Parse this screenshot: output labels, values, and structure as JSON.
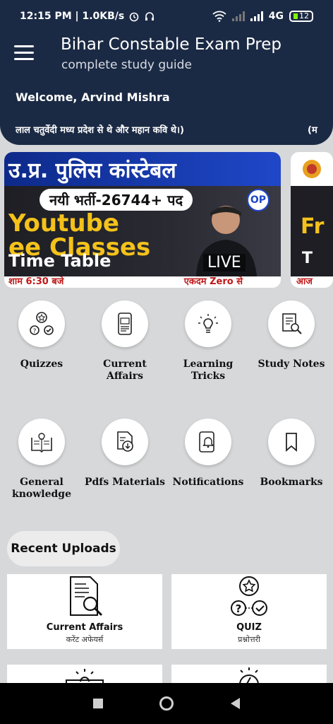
{
  "status": {
    "time": "12:15 PM | 1.0KB/s",
    "network": "4G",
    "battery": "12"
  },
  "header": {
    "title": "Bihar Constable Exam Prep",
    "subtitle": "complete study guide"
  },
  "welcome": {
    "text": "Welcome, Arvind Mishra",
    "marquee": "लाल चतुर्वेदी मध्य प्रदेश से थे और महान कवि थे।)",
    "marquee_tail": "(म"
  },
  "banner": {
    "headline": "उ.प्र. पुलिस कांस्टेबल",
    "pill": "नयी भर्ती-26744+ पद",
    "yt_line1": "Youtube",
    "yt_line2": "ee Classes",
    "timetable": "Time Table",
    "live": "LIVE",
    "logo": "OP",
    "footer_left": "शाम 6:30 बजे",
    "footer_right": "एकदम Zero से",
    "next_top": "Fr",
    "next_mid": "T",
    "next_foot": "आज"
  },
  "menu": [
    {
      "label": "Quizzes",
      "icon": "quiz-icon"
    },
    {
      "label": "Current Affairs",
      "icon": "phone-news-icon"
    },
    {
      "label": "Learning Tricks",
      "icon": "bulb-icon"
    },
    {
      "label": "Study Notes",
      "icon": "notes-search-icon"
    },
    {
      "label": "General knowledge",
      "icon": "book-bulb-icon"
    },
    {
      "label": "Pdfs Materials",
      "icon": "pdf-download-icon"
    },
    {
      "label": "Notifications",
      "icon": "bell-phone-icon"
    },
    {
      "label": "Bookmarks",
      "icon": "bookmark-icon"
    }
  ],
  "recent": {
    "title": "Recent Uploads",
    "cards": [
      {
        "title": "Current Affairs",
        "sub": "करेंट अफेयर्स"
      },
      {
        "title": "QUIZ",
        "sub": "प्रश्नोत्तरी"
      }
    ]
  }
}
